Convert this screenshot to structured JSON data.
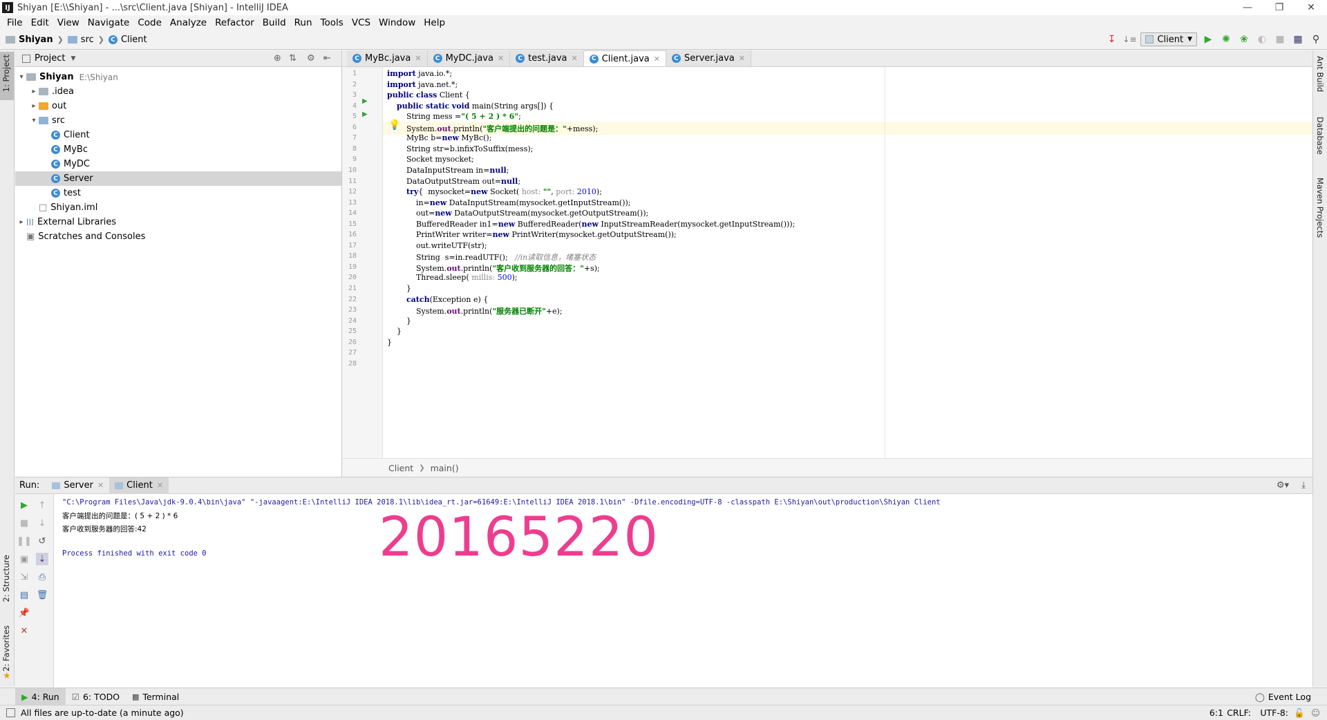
{
  "window": {
    "title": "Shiyan [E:\\\\Shiyan] - ...\\src\\Client.java [Shiyan] - IntelliJ IDEA",
    "app_icon": "IJ"
  },
  "menu": [
    "File",
    "Edit",
    "View",
    "Navigate",
    "Code",
    "Analyze",
    "Refactor",
    "Build",
    "Run",
    "Tools",
    "VCS",
    "Window",
    "Help"
  ],
  "breadcrumb": {
    "project": "Shiyan",
    "folder": "src",
    "file": "Client"
  },
  "toolbar": {
    "run_config": "Client"
  },
  "left_stripe": {
    "project_tab": "1: Project",
    "structure_tab": "2: Structure",
    "favorites_tab": "2: Favorites"
  },
  "right_stripe": {
    "ant": "Ant Build",
    "database": "Database",
    "maven": "Maven Projects"
  },
  "project_panel": {
    "title": "Project",
    "tree": [
      {
        "label": "Shiyan",
        "extra": "E:\\Shiyan",
        "indent": 0,
        "arrow": "▾",
        "icon": "folder-grey"
      },
      {
        "label": ".idea",
        "extra": "",
        "indent": 1,
        "arrow": "▸",
        "icon": "folder-grey"
      },
      {
        "label": "out",
        "extra": "",
        "indent": 1,
        "arrow": "▸",
        "icon": "folder-orange"
      },
      {
        "label": "src",
        "extra": "",
        "indent": 1,
        "arrow": "▾",
        "icon": "folder-blue"
      },
      {
        "label": "Client",
        "extra": "",
        "indent": 2,
        "arrow": "",
        "icon": "class"
      },
      {
        "label": "MyBc",
        "extra": "",
        "indent": 2,
        "arrow": "",
        "icon": "class"
      },
      {
        "label": "MyDC",
        "extra": "",
        "indent": 2,
        "arrow": "",
        "icon": "class"
      },
      {
        "label": "Server",
        "extra": "",
        "indent": 2,
        "arrow": "",
        "icon": "class"
      },
      {
        "label": "test",
        "extra": "",
        "indent": 2,
        "arrow": "",
        "icon": "class"
      },
      {
        "label": "Shiyan.iml",
        "extra": "",
        "indent": 1,
        "arrow": "",
        "icon": "file"
      },
      {
        "label": "External Libraries",
        "extra": "",
        "indent": 0,
        "arrow": "▸",
        "icon": "library"
      },
      {
        "label": "Scratches and Consoles",
        "extra": "",
        "indent": 0,
        "arrow": "",
        "icon": "scratch"
      }
    ]
  },
  "editor_tabs": [
    {
      "label": "MyBc.java",
      "active": false
    },
    {
      "label": "MyDC.java",
      "active": false
    },
    {
      "label": "test.java",
      "active": false
    },
    {
      "label": "Client.java",
      "active": true
    },
    {
      "label": "Server.java",
      "active": false
    }
  ],
  "code_lines": [
    "import java.io.*;",
    "import java.net.*;",
    "public class Client {",
    "    public static void main(String args[]) {",
    "        String mess =\"( 5 + 2 ) * 6\";",
    "        System.out.println(\"客户端提出的问题是：\"+mess);",
    "        MyBc b=new MyBc();",
    "        String str=b.infixToSuffix(mess);",
    "        Socket mysocket;",
    "        DataInputStream in=null;",
    "        DataOutputStream out=null;",
    "        try{  mysocket=new Socket( host: \"\", port: 2010);",
    "            in=new DataInputStream(mysocket.getInputStream());",
    "            out=new DataOutputStream(mysocket.getOutputStream());",
    "            BufferedReader in1=new BufferedReader(new InputStreamReader(mysocket.getInputStream()));",
    "            PrintWriter writer=new PrintWriter(mysocket.getOutputStream());",
    "            out.writeUTF(str);",
    "            String  s=in.readUTF();   //in读取信息，堵塞状态",
    "            System.out.println(\"客户收到服务器的回答：\"+s);",
    "            Thread.sleep( millis: 500);",
    "        }",
    "        catch(Exception e) {",
    "            System.out.println(\"服务器已断开\"+e);",
    "        }",
    "    }",
    "}",
    "",
    ""
  ],
  "editor_footer": {
    "class": "Client",
    "method": "main()"
  },
  "run_panel": {
    "label": "Run:",
    "tabs": [
      {
        "label": "Server",
        "active": false
      },
      {
        "label": "Client",
        "active": true
      }
    ],
    "console": [
      "\"C:\\Program Files\\Java\\jdk-9.0.4\\bin\\java\" \"-javaagent:E:\\IntelliJ IDEA 2018.1\\lib\\idea_rt.jar=61649:E:\\IntelliJ IDEA 2018.1\\bin\" -Dfile.encoding=UTF-8 -classpath E:\\Shiyan\\out\\production\\Shiyan Client",
      "客户端提出的问题是：( 5 + 2 ) * 6",
      "客户收到服务器的回答:42",
      "",
      "Process finished with exit code 0"
    ],
    "watermark": "20165220"
  },
  "bottom_tabs": [
    {
      "label": "4: Run",
      "active": true
    },
    {
      "label": "6: TODO",
      "active": false
    },
    {
      "label": "Terminal",
      "active": false
    }
  ],
  "event_log": "Event Log",
  "status": {
    "message": "All files are up-to-date (a minute ago)",
    "position": "6:1",
    "line_sep": "CRLF:",
    "encoding": "UTF-8:"
  },
  "colors": {
    "watermark": "#ee3d8f",
    "keyword": "#000080",
    "string": "#008000",
    "run_green": "#2fa82f"
  }
}
